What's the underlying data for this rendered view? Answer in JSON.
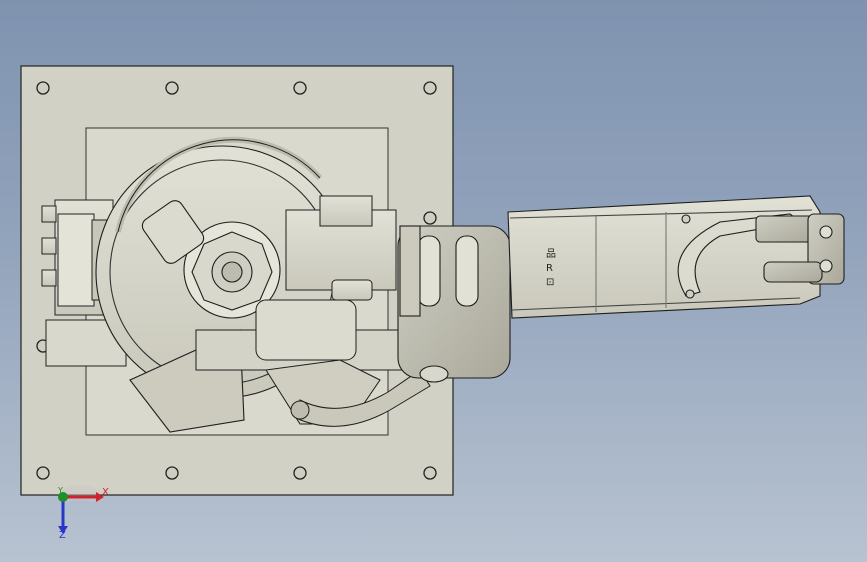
{
  "viewport": {
    "background_top": "#7f93b0",
    "background_bottom": "#b8c3d1",
    "model_color": "#d6d5c9",
    "edge_color": "#1e1e1e"
  },
  "model": {
    "arm_markings": [
      "品",
      "R",
      "⊡"
    ]
  },
  "triad": {
    "x_label": "X",
    "y_label": "Y",
    "z_label": "Z",
    "x_color": "#d0242a",
    "y_color": "#1f8f2a",
    "z_color": "#2836c8"
  }
}
